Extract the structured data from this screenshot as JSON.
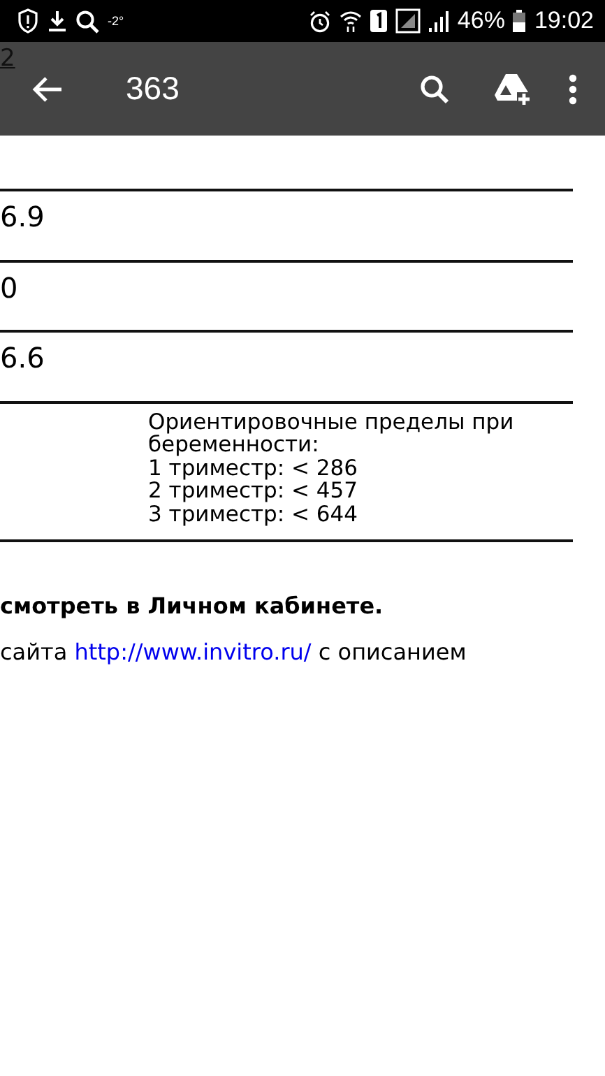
{
  "status_bar": {
    "temperature": "-2°",
    "battery": "46%",
    "time": "19:02"
  },
  "toolbar": {
    "page_fragment": "2",
    "title": "363"
  },
  "table": {
    "rows": [
      {
        "kind": "value",
        "text": "6.9"
      },
      {
        "kind": "value",
        "text": "0"
      },
      {
        "kind": "value",
        "text": "6.6"
      },
      {
        "kind": "note",
        "lines": [
          "Ориентировочные пределы при",
          "беременности:",
          "1 триместр: < 286",
          "2 триместр: < 457",
          "3 триместр: < 644"
        ]
      }
    ]
  },
  "notes": [
    {
      "kind": "bold",
      "text": "смотреть в Личном кабинете."
    },
    {
      "kind": "link_sentence",
      "before": "сайта ",
      "link": "http://www.invitro.ru/",
      "after": " с описанием"
    }
  ]
}
